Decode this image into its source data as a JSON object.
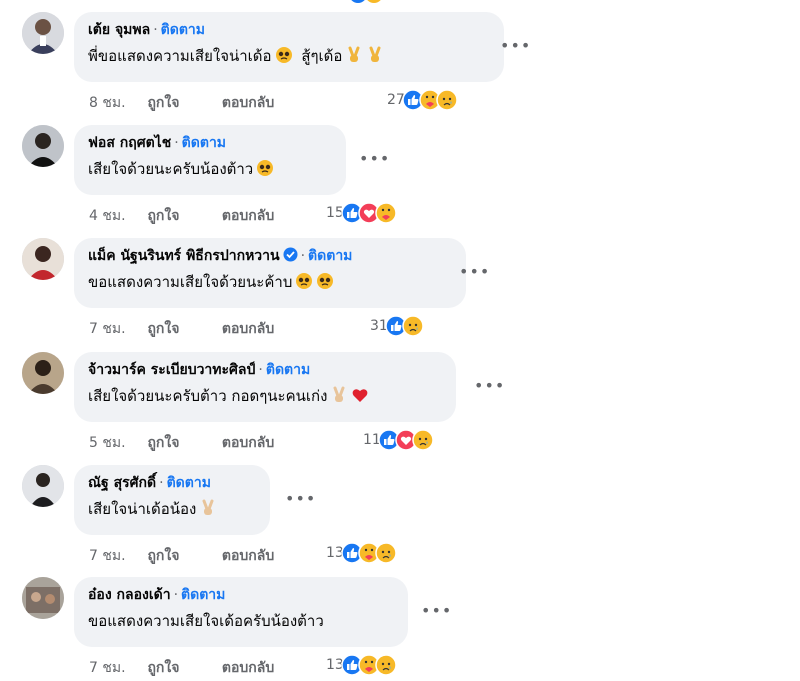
{
  "colors": {
    "link_blue": "#1877f2",
    "meta_gray": "#65676b",
    "bubble_bg": "#f0f2f5"
  },
  "actions": {
    "like_label": "ถูกใจ",
    "reply_label": "ตอบกลับ"
  },
  "comments": [
    {
      "author": "เต้ย จุมพล",
      "follow": "ติดตาม",
      "text": "พี่ขอแสดงความเสียใจน่าเด้อ",
      "text2": "สู้ๆเด้อ",
      "time": "8 ชม.",
      "reaction_count": "27",
      "reactions": [
        "like-icon",
        "care-icon",
        "sad-icon"
      ]
    },
    {
      "author": "ฟอส กฤศตไช",
      "follow": "ติดตาม",
      "text": "เสียใจด้วยนะครับน้องต้าว",
      "time": "4 ชม.",
      "reaction_count": "15",
      "reactions": [
        "like-icon",
        "love-icon",
        "care-icon"
      ]
    },
    {
      "author": "แม็ค นัฐนรินทร์ พิธีกรปากหวาน",
      "follow": "ติดตาม",
      "text": "ขอแสดงความเสียใจด้วยนะค้าบ",
      "time": "7 ชม.",
      "reaction_count": "31",
      "reactions": [
        "like-icon",
        "sad-icon"
      ]
    },
    {
      "author": "จ้าวมาร์ค ระเบียบวาทะศิลป์",
      "follow": "ติดตาม",
      "text": "เสียใจด้วยนะครับต้าว กอดๆนะคนเก่ง",
      "time": "5 ชม.",
      "reaction_count": "11",
      "reactions": [
        "like-icon",
        "love-icon",
        "sad-icon"
      ]
    },
    {
      "author": "ณัฐ สุรศักดิ์",
      "follow": "ติดตาม",
      "text": "เสียใจน่าเด้อน้อง",
      "time": "7 ชม.",
      "reaction_count": "13",
      "reactions": [
        "like-icon",
        "care-icon",
        "sad-icon"
      ]
    },
    {
      "author": "อ๋อง กลองเด้า",
      "follow": "ติดตาม",
      "text": "ขอแสดงความเสียใจเด้อครับน้องต้าว",
      "time": "7 ชม.",
      "reaction_count": "13",
      "reactions": [
        "like-icon",
        "care-icon",
        "sad-icon"
      ]
    }
  ]
}
